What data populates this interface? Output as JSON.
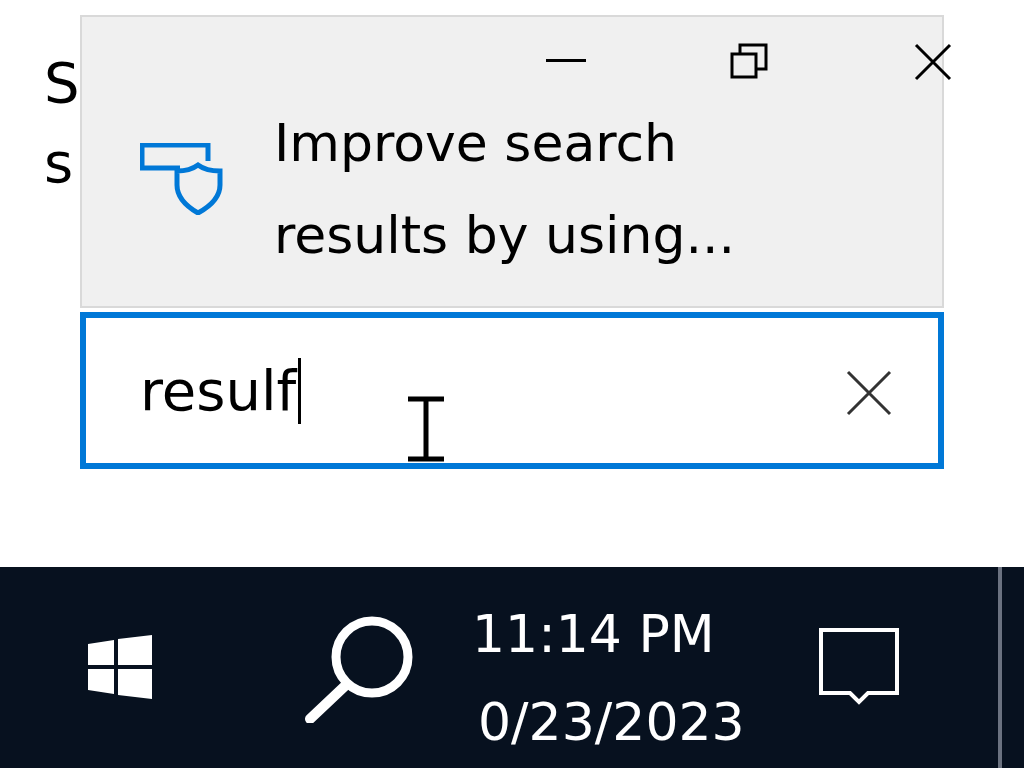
{
  "background_text": [
    "S",
    "s"
  ],
  "notice": {
    "message": "Improve search results by using..."
  },
  "search": {
    "value": "resulf"
  },
  "taskbar": {
    "time": "11:14 PM",
    "date": "0/23/2023"
  }
}
